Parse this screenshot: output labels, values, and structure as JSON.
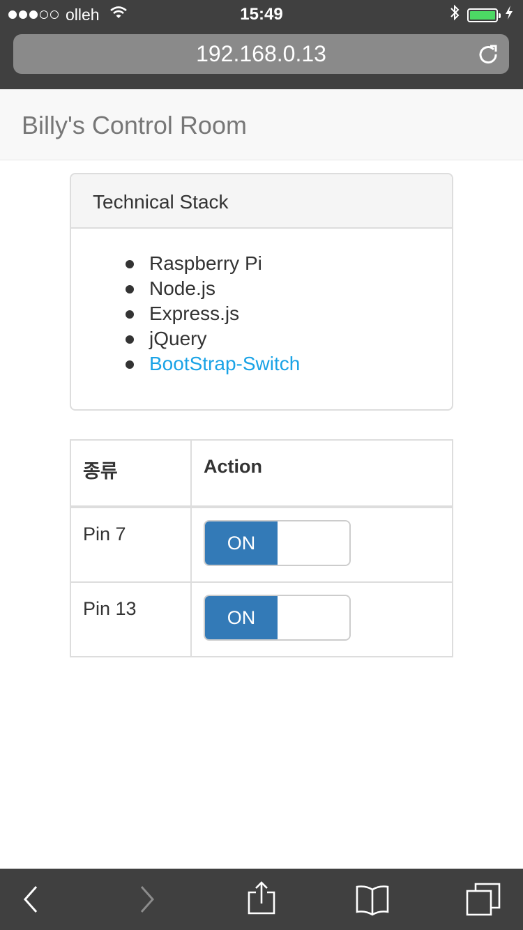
{
  "status_bar": {
    "carrier": "olleh",
    "time": "15:49",
    "signal_icon": "signal-dots-icon",
    "wifi_icon": "wifi-icon",
    "bluetooth_icon": "bluetooth-icon",
    "battery_icon": "battery-icon",
    "charging_icon": "lightning-icon",
    "battery_color": "#4cd964"
  },
  "browser": {
    "url": "192.168.0.13",
    "reload_icon": "reload-icon"
  },
  "navbar": {
    "brand": "Billy's Control Room"
  },
  "panel": {
    "heading": "Technical Stack",
    "items": [
      {
        "label": "Raspberry Pi"
      },
      {
        "label": "Node.js"
      },
      {
        "label": "Express.js"
      },
      {
        "label": "jQuery"
      },
      {
        "label": "BootStrap-Switch",
        "link": true
      }
    ],
    "link_color": "#1aa3e6"
  },
  "table": {
    "headers": [
      "종류",
      "Action"
    ],
    "rows": [
      {
        "name": "Pin 7",
        "switch_label": "ON",
        "state": "on"
      },
      {
        "name": "Pin 13",
        "switch_label": "ON",
        "state": "on"
      }
    ],
    "switch_color": "#337ab7"
  },
  "toolbar": {
    "icons": [
      "back-icon",
      "forward-icon",
      "share-icon",
      "bookmarks-icon",
      "tabs-icon"
    ]
  }
}
